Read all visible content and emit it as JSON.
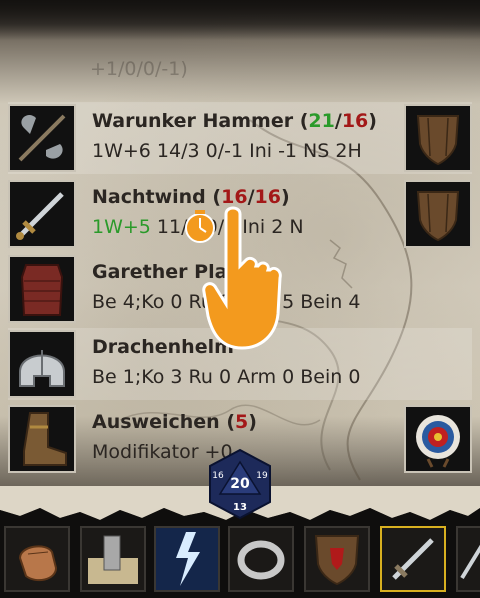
{
  "ghost_row": "+1/0/0/-1)",
  "rows": [
    {
      "name": "Warunker Hammer",
      "value_a": "21",
      "value_b": "16",
      "value_a_color": "#2a9a2a",
      "value_b_color": "#a31818",
      "sub": "1W+6 14/3 0/-1 Ini -1 NS 2H",
      "left_icon": "battleaxe-icon",
      "right_icon": "wooden-shield-icon"
    },
    {
      "name": "Nachtwind",
      "value_a": "16",
      "value_b": "16",
      "value_a_color": "#a31818",
      "value_b_color": "#a31818",
      "sub_damage": "1W+5",
      "sub_rest": " 11/4 0/0 Ini 2 N",
      "left_icon": "sword-icon",
      "right_icon": "wooden-shield-icon"
    },
    {
      "name": "Garether Platte",
      "sub": "Be 4;Ko 0 Ru 0 Arm 5 Bein 4",
      "left_icon": "chainmail-icon"
    },
    {
      "name": "Drachenhelm",
      "sub": "Be 1;Ko 3 Ru 0 Arm 0 Bein 0",
      "left_icon": "helmet-icon"
    },
    {
      "name": "Ausweichen",
      "value_a": "5",
      "value_a_color": "#a31818",
      "sub": "Modifikator +0",
      "left_icon": "boot-icon",
      "right_icon": "target-icon"
    }
  ],
  "dice": {
    "top": "20",
    "bottom": "13",
    "left": "16",
    "right": "19"
  },
  "toolbar": [
    {
      "icon": "fist-icon"
    },
    {
      "icon": "tower-map-icon"
    },
    {
      "icon": "lightning-icon"
    },
    {
      "icon": "ring-icon"
    },
    {
      "icon": "red-shield-icon"
    },
    {
      "icon": "sword-icon",
      "selected": true
    },
    {
      "icon": "partial-item-icon"
    }
  ],
  "colors": {
    "accent_gold": "#d8b020",
    "red": "#a31818",
    "green": "#2a9a2a",
    "hand": "#f39a1e"
  }
}
